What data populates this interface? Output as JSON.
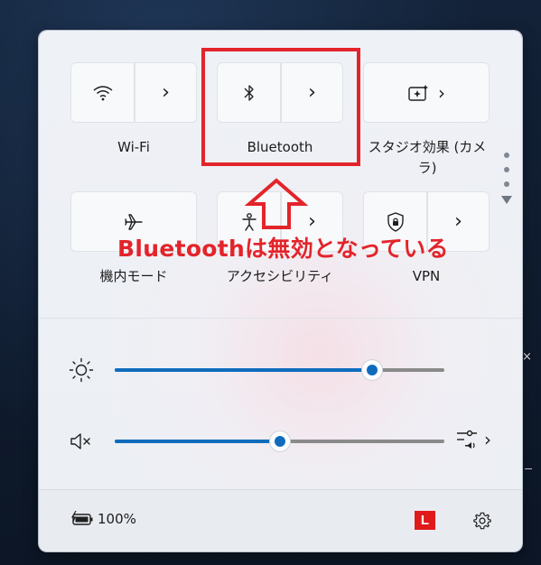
{
  "quick_settings": {
    "tiles": [
      {
        "id": "wifi",
        "label": "Wi-Fi",
        "icon": "wifi-icon",
        "has_arrow": true,
        "state": "off"
      },
      {
        "id": "bluetooth",
        "label": "Bluetooth",
        "icon": "bluetooth-icon",
        "has_arrow": true,
        "state": "off"
      },
      {
        "id": "studio",
        "label": "スタジオ効果 (カメラ)",
        "icon": "studio-effects-icon",
        "has_arrow": true,
        "state": "off"
      },
      {
        "id": "airplane",
        "label": "機内モード",
        "icon": "airplane-icon",
        "has_arrow": false,
        "state": "off"
      },
      {
        "id": "accessibility",
        "label": "アクセシビリティ",
        "icon": "accessibility-icon",
        "has_arrow": true,
        "state": "off"
      },
      {
        "id": "vpn",
        "label": "VPN",
        "icon": "vpn-shield-icon",
        "has_arrow": true,
        "state": "off"
      }
    ],
    "brightness": {
      "icon": "brightness-icon",
      "value": 0.78
    },
    "volume": {
      "icon": "speaker-muted-icon",
      "value": 0.5,
      "output_icon": "audio-output-icon"
    },
    "footer": {
      "battery_icon": "battery-charging-icon",
      "battery_text": "100%",
      "app_badge": "L",
      "settings_icon": "gear-icon"
    }
  },
  "annotation": {
    "text": "Bluetoothは無効となっている",
    "color": "#e3242b"
  },
  "colors": {
    "accent": "#0f6cbd",
    "annotation": "#e3242b"
  }
}
